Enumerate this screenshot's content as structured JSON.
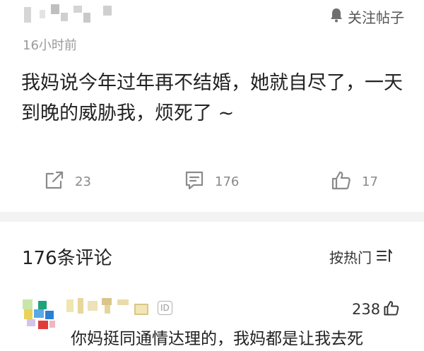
{
  "post": {
    "follow_label": "关注帖子",
    "time": "16小时前",
    "body": "我妈说今年过年再不结婚，她就自尽了，一天到晚的威胁我，烦死了 ~",
    "actions": [
      {
        "icon": "share-icon",
        "count": "23"
      },
      {
        "icon": "comment-icon",
        "count": "176"
      },
      {
        "icon": "thumbs-up-icon",
        "count": "17"
      }
    ]
  },
  "comments_section": {
    "title": "176条评论",
    "sort_label": "按热门"
  },
  "comment": {
    "badge": "ID",
    "likes": "238",
    "text": "你妈挺同通情达理的，我妈都是让我去死"
  },
  "colors": {
    "text": "#222222",
    "muted": "#9a9a9a",
    "icon": "#8a8a8a",
    "separator": "#f3f3f3"
  }
}
